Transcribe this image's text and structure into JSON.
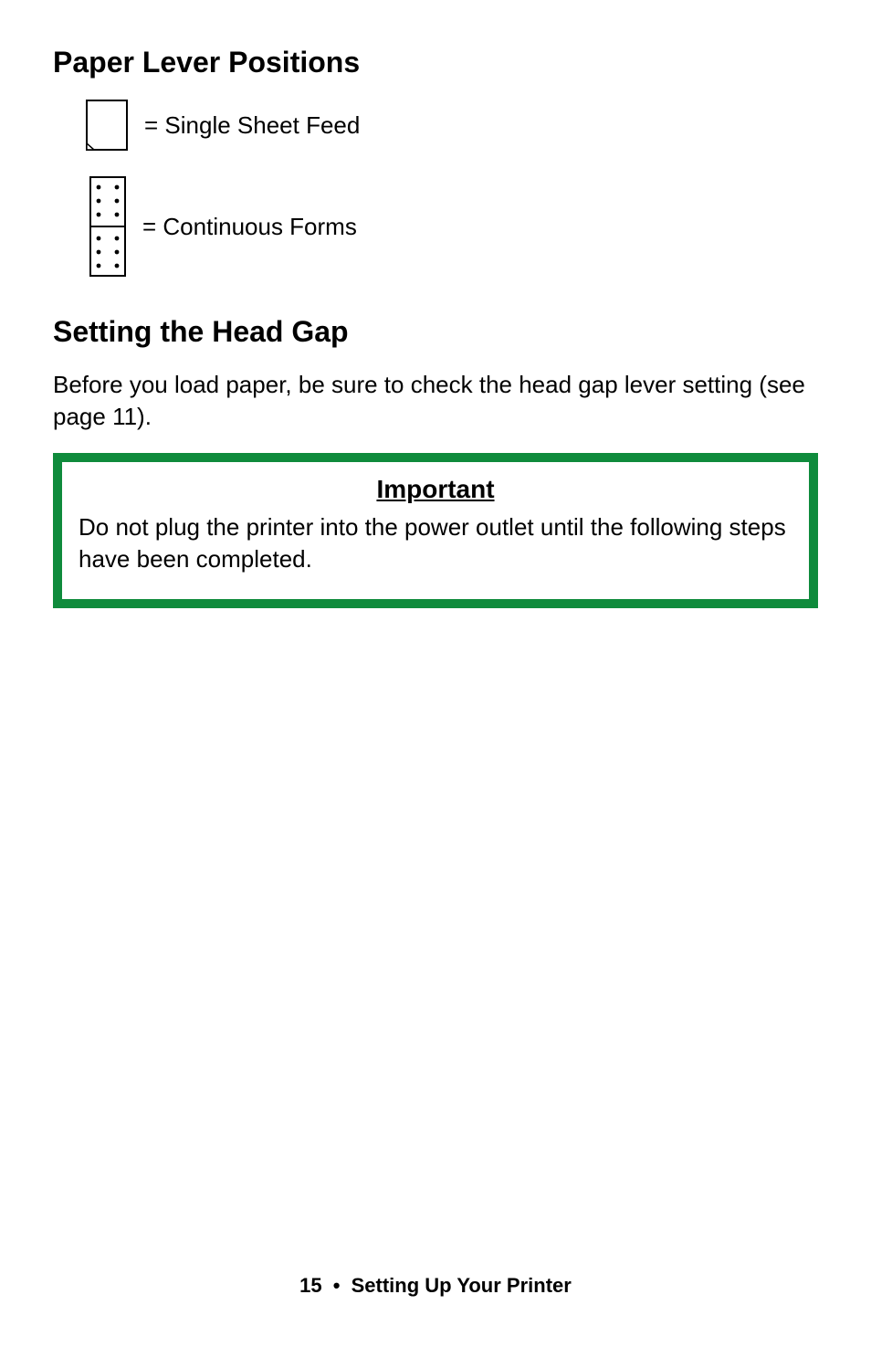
{
  "headings": {
    "paperLever": "Paper Lever Positions",
    "headGap": "Setting the Head Gap"
  },
  "leverItems": {
    "singleSheet": "= Single Sheet Feed",
    "continuousForms": "= Continuous Forms"
  },
  "bodyText": "Before you load paper, be sure to check the head gap lever setting (see page 11).",
  "callout": {
    "title": "Important",
    "body": "Do not plug the printer into the power outlet until the following steps have been completed."
  },
  "footer": {
    "page": "15",
    "bullet": "•",
    "section": "Setting Up Your Printer"
  }
}
